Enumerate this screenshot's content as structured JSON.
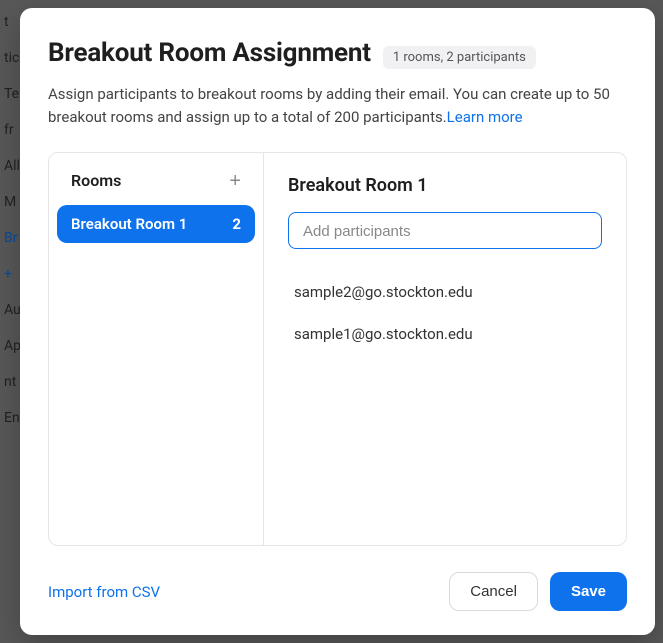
{
  "background": {
    "rows": [
      "t",
      "tic",
      "Te",
      "fr",
      "",
      "All",
      "",
      "M",
      "",
      "Br",
      "+",
      "",
      "Au",
      "",
      "Ap",
      "",
      "nt",
      "",
      "En"
    ]
  },
  "modal": {
    "title": "Breakout Room Assignment",
    "summary": "1 rooms, 2 participants",
    "desc_text": "Assign participants to breakout rooms by adding their email. You can create up to 50 breakout rooms and assign up to a total of 200 participants.",
    "learn_more": "Learn more"
  },
  "rooms": {
    "header": "Rooms",
    "items": [
      {
        "name": "Breakout Room 1",
        "count": "2"
      }
    ]
  },
  "detail": {
    "title": "Breakout Room 1",
    "placeholder": "Add participants",
    "participants": [
      "sample2@go.stockton.edu",
      "sample1@go.stockton.edu"
    ]
  },
  "footer": {
    "import": "Import from CSV",
    "cancel": "Cancel",
    "save": "Save"
  }
}
